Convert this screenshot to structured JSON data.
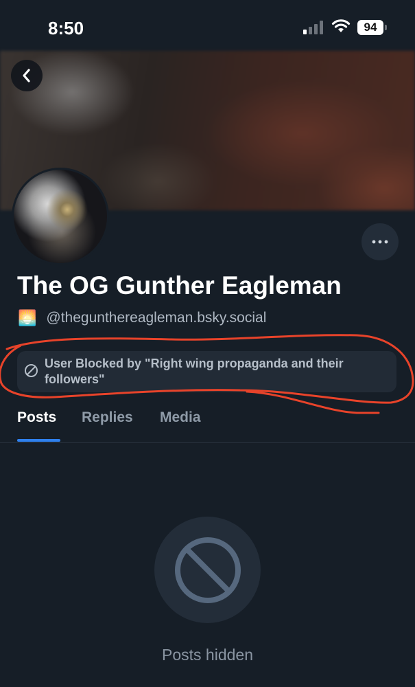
{
  "status_bar": {
    "time": "8:50",
    "battery": "94",
    "icons": [
      "signal-icon",
      "wifi-icon",
      "battery-icon"
    ]
  },
  "header": {
    "back_icon": "chevron-left-icon",
    "more_icon": "ellipsis-icon"
  },
  "profile": {
    "display_name": "The OG Gunther Eagleman",
    "emoji": "🌅",
    "handle": "@thegunthereagleman.bsky.social",
    "blocked_notice": "User Blocked by \"Right wing propaganda and their followers\""
  },
  "tabs": [
    {
      "label": "Posts",
      "active": true
    },
    {
      "label": "Replies",
      "active": false
    },
    {
      "label": "Media",
      "active": false
    }
  ],
  "empty_state": {
    "icon": "block-icon",
    "text": "Posts hidden"
  },
  "colors": {
    "background": "#161e27",
    "accent": "#2f80ed",
    "annotation": "#e8432a"
  }
}
